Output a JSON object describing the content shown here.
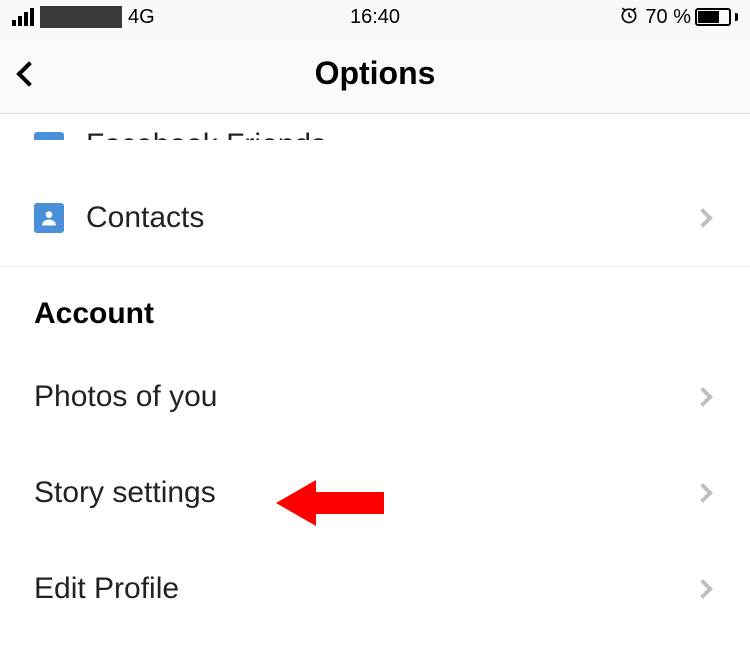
{
  "statusBar": {
    "network": "4G",
    "time": "16:40",
    "batteryPercent": "70 %"
  },
  "header": {
    "title": "Options"
  },
  "partialRow": {
    "label": "Facebook Friends"
  },
  "contacts": {
    "label": "Contacts"
  },
  "section": {
    "title": "Account"
  },
  "rows": {
    "photos": "Photos of you",
    "story": "Story settings",
    "edit": "Edit Profile"
  }
}
